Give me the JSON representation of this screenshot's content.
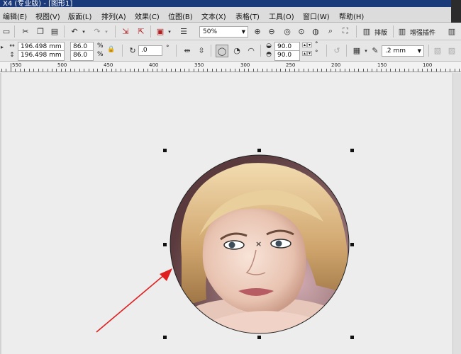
{
  "window": {
    "title": "X4 (专业版) - [图形1]"
  },
  "menubar": {
    "items": [
      {
        "label": "编辑(E)"
      },
      {
        "label": "视图(V)"
      },
      {
        "label": "版面(L)"
      },
      {
        "label": "排列(A)"
      },
      {
        "label": "效果(C)"
      },
      {
        "label": "位图(B)"
      },
      {
        "label": "文本(X)"
      },
      {
        "label": "表格(T)"
      },
      {
        "label": "工具(O)"
      },
      {
        "label": "窗口(W)"
      },
      {
        "label": "帮助(H)"
      }
    ]
  },
  "toolbar": {
    "zoom_value": "50%",
    "layout_label": "排版",
    "plugins_label": "增强插件"
  },
  "property_bar": {
    "width_value": "196.498 mm",
    "height_value": "196.498 mm",
    "scale_x": "86.0",
    "scale_y": "86.0",
    "percent_symbol": "%",
    "rotation_value": ".0",
    "degree_symbol": "°",
    "start_angle": "90.0",
    "end_angle": "90.0",
    "outline_width": ".2 mm"
  },
  "ruler": {
    "labels": [
      "550",
      "500",
      "450",
      "400",
      "350",
      "300",
      "250",
      "200",
      "150",
      "100"
    ]
  },
  "colors": {
    "title_bar": "#1b3a7a",
    "arrow": "#e02020",
    "canvas": "#ededed"
  }
}
